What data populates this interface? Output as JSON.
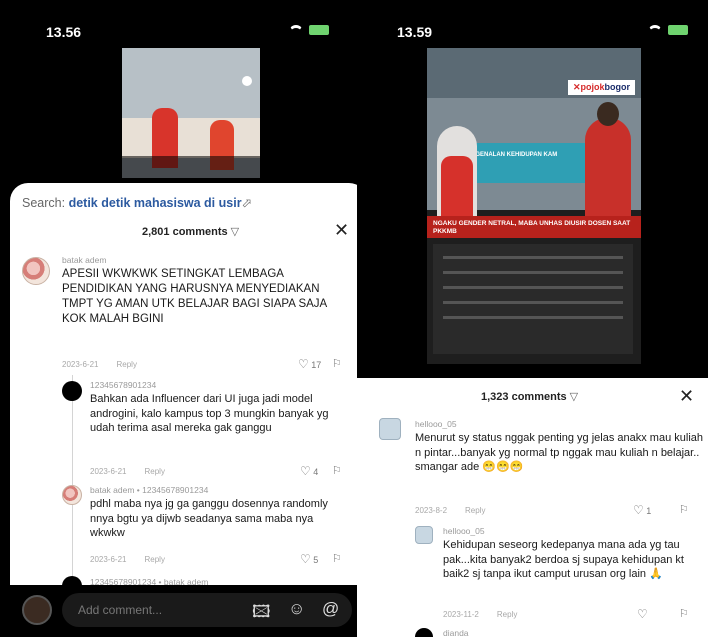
{
  "left": {
    "status": {
      "time": "13.56"
    },
    "search": {
      "prefix": "Search:",
      "query": "detik detik mahasiswa di usir"
    },
    "comments_count": "2,801 comments",
    "comments": [
      {
        "user": "batak adem",
        "text": "APESII WKWKWK SETINGKAT LEMBAGA PENDIDIKAN YANG HARUSNYA MENYEDIAKAN TMPT YG AMAN UTK BELAJAR BAGI SIAPA SAJA KOK MALAH BGINI",
        "date": "2023-6-21",
        "reply": "Reply",
        "likes": "17"
      },
      {
        "user": "12345678901234",
        "text": "Bahkan ada Influencer dari UI juga jadi model androgini, kalo kampus top 3 mungkin banyak yg udah terima asal mereka gak ganggu",
        "date": "2023-6-21",
        "reply": "Reply",
        "likes": "4"
      },
      {
        "user": "batak adem • 12345678901234",
        "text": "pdhl maba nya jg ga ganggu dosennya randomly nnya bgtu ya dijwb seadanya sama maba nya wkwkw",
        "date": "2023-6-21",
        "reply": "Reply",
        "likes": "5"
      },
      {
        "user": "12345678901234 • batak adem"
      }
    ],
    "input": {
      "placeholder": "Add comment...",
      "icons": [
        "image-icon",
        "emoji-icon",
        "mention-icon"
      ]
    }
  },
  "right": {
    "status": {
      "time": "13.59"
    },
    "video": {
      "logo_prefix": "✕",
      "logo_accent": "pojok",
      "logo_rest": "bogor",
      "banner_text": "PENGENALAN KEHIDUPAN KAM",
      "headline": "NGAKU GENDER NETRAL, MABA UNHAS DIUSIR DOSEN SAAT PKKMB"
    },
    "comments_count": "1,323 comments",
    "comments": [
      {
        "user": "hellooo_05",
        "text": "Menurut sy status nggak penting yg jelas anakx mau kuliah n pintar...banyak yg normal tp nggak mau kuliah n belajar.. smangar ade 😁😁😁",
        "date": "2023-8-2",
        "reply": "Reply",
        "likes": "1"
      },
      {
        "user": "hellooo_05",
        "text": "Kehidupan seseorg kedepanya mana ada yg tau pak...kita banyak2 berdoa sj supaya kehidupan kt baik2 sj tanpa ikut camput urusan org lain 🙏",
        "date": "2023-11-2",
        "reply": "Reply",
        "likes": ""
      },
      {
        "user": "dianda"
      }
    ]
  },
  "colors": {
    "link": "#2c5aa0",
    "sheet": "#ffffff",
    "battery": "#6fd36f"
  }
}
